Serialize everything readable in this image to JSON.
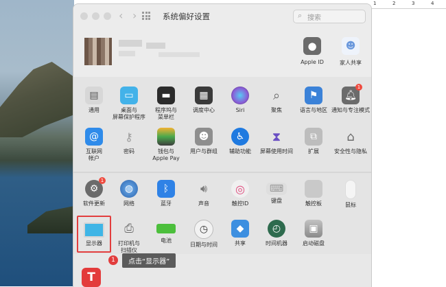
{
  "window": {
    "title": "系统偏好设置",
    "search_placeholder": "搜索"
  },
  "ruler": {
    "marks": [
      "1",
      "2",
      "3",
      "4"
    ]
  },
  "account": {
    "items": [
      {
        "label": "Apple ID",
        "icon": "apple-id-icon",
        "color": "#6b6b6b"
      },
      {
        "label": "家人共享",
        "icon": "family-sharing-icon",
        "color": "#8fb4e8"
      }
    ]
  },
  "section1": [
    {
      "label": "通用",
      "icon": "general-icon",
      "color": "#d7d7d7"
    },
    {
      "label": "桌面与\n屏幕保护程序",
      "icon": "desktop-screensaver-icon",
      "color": "#43b2e9"
    },
    {
      "label": "程序坞与\n菜单栏",
      "icon": "dock-icon",
      "color": "#2b2b2b"
    },
    {
      "label": "调度中心",
      "icon": "mission-control-icon",
      "color": "#3a3a3a"
    },
    {
      "label": "Siri",
      "icon": "siri-icon",
      "color": "#8a5cd6"
    },
    {
      "label": "聚焦",
      "icon": "spotlight-icon",
      "color": "#d8d8d8"
    },
    {
      "label": "语言与地区",
      "icon": "language-region-icon",
      "color": "#3b82d8"
    },
    {
      "label": "通知与专注模式",
      "icon": "notifications-icon",
      "color": "#e35a52",
      "badge": "1"
    },
    {
      "label": "互联网\n帐户",
      "icon": "internet-accounts-icon",
      "color": "#2f8bea"
    },
    {
      "label": "密码",
      "icon": "passwords-icon",
      "color": "#cfcfcf"
    },
    {
      "label": "钱包与\nApple Pay",
      "icon": "wallet-icon",
      "color": "#3d3d3d"
    },
    {
      "label": "用户与群组",
      "icon": "users-groups-icon",
      "color": "#8e8e8e"
    },
    {
      "label": "辅助功能",
      "icon": "accessibility-icon",
      "color": "#1f7ae0"
    },
    {
      "label": "屏幕使用时间",
      "icon": "screen-time-icon",
      "color": "#6a4fc3"
    },
    {
      "label": "扩展",
      "icon": "extensions-icon",
      "color": "#bdbdbd"
    },
    {
      "label": "安全性与隐私",
      "icon": "security-icon",
      "color": "#8c8c8c"
    }
  ],
  "section2": [
    {
      "label": "软件更新",
      "icon": "software-update-icon",
      "color": "#6b6b6b",
      "badge": "1"
    },
    {
      "label": "网络",
      "icon": "network-icon",
      "color": "#3a7fd1"
    },
    {
      "label": "蓝牙",
      "icon": "bluetooth-icon",
      "color": "#2f82e6"
    },
    {
      "label": "声音",
      "icon": "sound-icon",
      "color": "#a3a3a3"
    },
    {
      "label": "触控ID",
      "icon": "touch-id-icon",
      "color": "#f0f0f0"
    },
    {
      "label": "键盘",
      "icon": "keyboard-icon",
      "color": "#dedede"
    },
    {
      "label": "触控板",
      "icon": "trackpad-icon",
      "color": "#c9c9c9"
    },
    {
      "label": "鼠标",
      "icon": "mouse-icon",
      "color": "#f5f5f5"
    },
    {
      "label": "显示器",
      "icon": "displays-icon",
      "color": "#3fb5e6"
    },
    {
      "label": "打印机与\n扫描仪",
      "icon": "printers-icon",
      "color": "#8a8a8a"
    },
    {
      "label": "电池",
      "icon": "battery-icon",
      "color": "#4cbf3c"
    },
    {
      "label": "日期与时间",
      "icon": "date-time-icon",
      "color": "#f2f2f2"
    },
    {
      "label": "共享",
      "icon": "sharing-icon",
      "color": "#3d8fe0"
    },
    {
      "label": "时间机器",
      "icon": "time-machine-icon",
      "color": "#2e6b4e"
    },
    {
      "label": "启动磁盘",
      "icon": "startup-disk-icon",
      "color": "#9a9a9a"
    }
  ],
  "callout": {
    "number": "1",
    "text": "点击“显示器”"
  },
  "app_badge": {
    "letter": "T",
    "icon": "app-t-icon"
  }
}
